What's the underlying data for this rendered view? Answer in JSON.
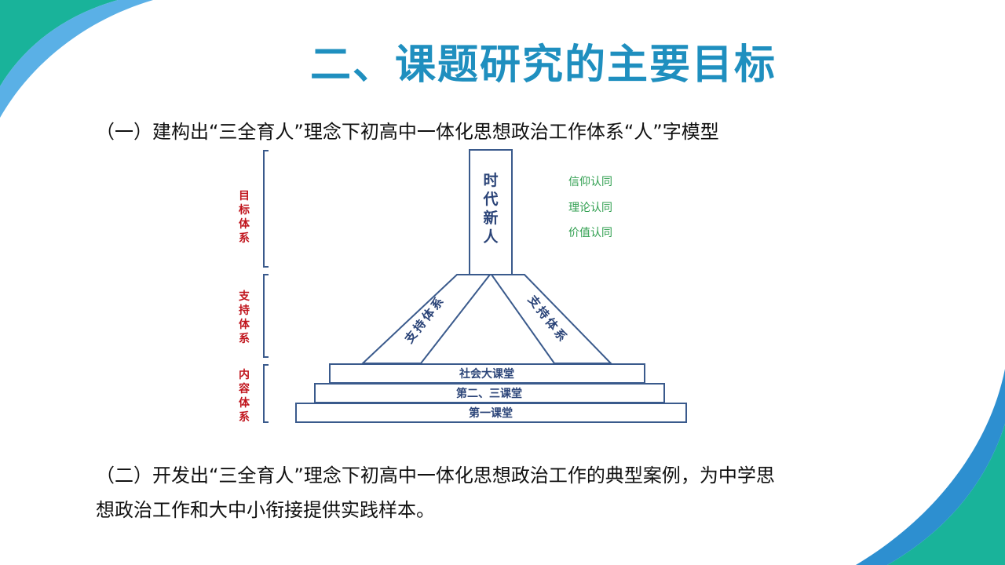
{
  "title": "二、课题研究的主要目标",
  "section1": "（一）建构出“三全育人”理念下初高中一体化思想政治工作体系“人”字模型",
  "diagram": {
    "left_labels": {
      "goal_system": [
        "目",
        "标",
        "体",
        "系"
      ],
      "support_system": [
        "支",
        "持",
        "体",
        "系"
      ],
      "content_system": [
        "内",
        "容",
        "体",
        "系"
      ]
    },
    "top_pillar": [
      "时",
      "代",
      "新",
      "人"
    ],
    "identities": [
      "信仰认同",
      "理论认同",
      "价值认同"
    ],
    "left_leg": "支持体系",
    "right_leg": "支持体系",
    "tiers": [
      "社会大课堂",
      "第二、三课堂",
      "第一课堂"
    ]
  },
  "section2": {
    "line1": "（二）开发出“三全育人”理念下初高中一体化思想政治工作的典型案例，为中学思",
    "line2": "想政治工作和大中小衔接提供实践样本。"
  },
  "colors": {
    "title": "#1f8fbf",
    "diagram_stroke": "#3a5a8c",
    "diagram_text": "#2b4478",
    "left_label": "#c0141c",
    "identity": "#2e9e4e",
    "deco_teal": "#19b39a",
    "deco_blue": "#2d8fd0"
  }
}
